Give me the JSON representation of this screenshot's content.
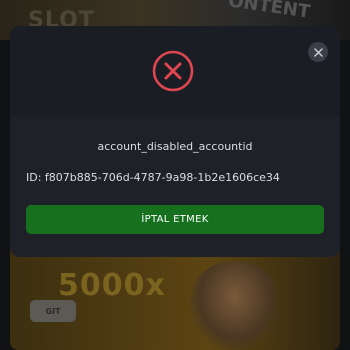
{
  "background": {
    "top_left_text": "SLOT",
    "top_right_text": "ONTENT",
    "banner_small_text": "",
    "banner_big_text": "5000x",
    "banner_button_label": "GIT"
  },
  "dialog": {
    "icon": "error-x-circle-icon",
    "close_icon": "close-icon",
    "message": "account_disabled_accountid",
    "account_id_text": "ID: f807b885-706d-4787-9a98-1b2e1606ce34",
    "cancel_label": "İPTAL ETMEK",
    "colors": {
      "error_red": "#e0464f",
      "button_green": "#16701e",
      "modal_bg": "#1f2129"
    }
  }
}
